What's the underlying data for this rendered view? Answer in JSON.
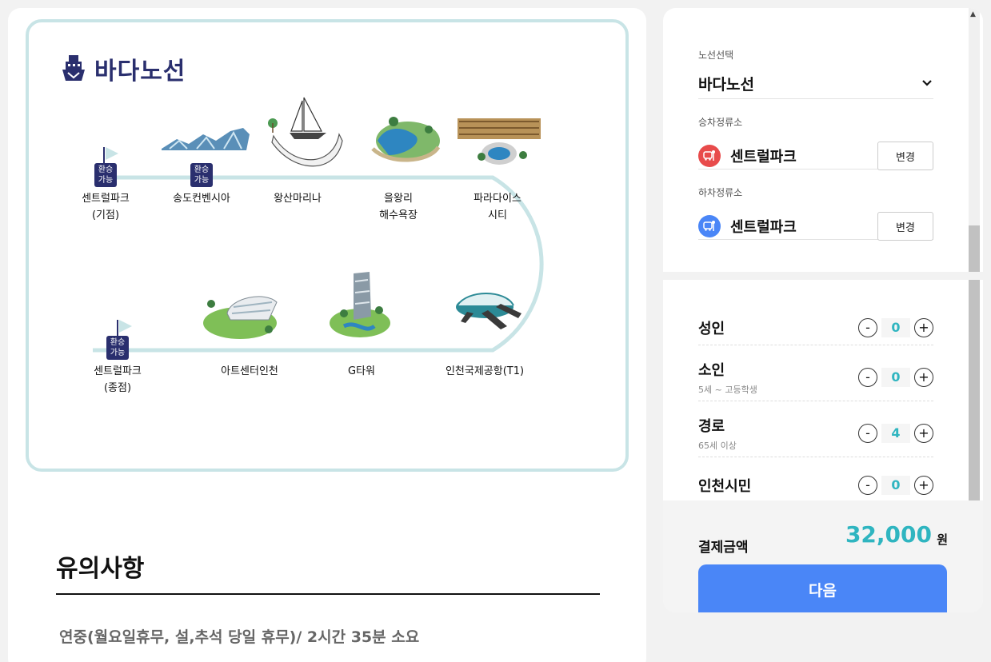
{
  "brand": {
    "name": "바다노선"
  },
  "route_map": {
    "stops": [
      {
        "label": "센트럴파크\n(기점)",
        "transfer": true
      },
      {
        "label": "송도컨벤시아",
        "transfer": true
      },
      {
        "label": "왕산마리나",
        "transfer": false
      },
      {
        "label": "을왕리\n해수욕장",
        "transfer": false
      },
      {
        "label": "파라다이스\n시티",
        "transfer": false
      },
      {
        "label": "인천국제공항(T1)",
        "transfer": false
      },
      {
        "label": "G타워",
        "transfer": false
      },
      {
        "label": "아트센터인천",
        "transfer": false
      },
      {
        "label": "센트럴파크\n(종점)",
        "transfer": true
      }
    ],
    "transfer_text": "환승\n가능",
    "colors": {
      "path": "#c8e4e6",
      "badge": "#2a2f6e"
    }
  },
  "notice": {
    "title": "유의사항",
    "text": "연중(월요일휴무, 설,추석 당일 휴무)/ 2시간 35분 소요"
  },
  "booking": {
    "route_label": "노선선택",
    "route_value": "바다노선",
    "boarding": {
      "label": "승차정류소",
      "stop": "센트럴파크",
      "button": "변경",
      "icon_color": "#e84b4b"
    },
    "alighting": {
      "label": "하차정류소",
      "stop": "센트럴파크",
      "button": "변경",
      "icon_color": "#4a86f7"
    },
    "passengers": [
      {
        "name": "성인",
        "sub": "",
        "count": "0"
      },
      {
        "name": "소인",
        "sub": "5세 ~ 고등학생",
        "count": "0"
      },
      {
        "name": "경로",
        "sub": "65세 이상",
        "count": "4"
      },
      {
        "name": "인천시민",
        "sub": "",
        "count": "0"
      }
    ],
    "minus": "-",
    "plus": "+",
    "payment": {
      "label": "결제금액",
      "amount": "32,000",
      "unit": "원"
    },
    "next_button": "다음",
    "accent_color": "#2fb5c0",
    "button_color": "#4a86f7"
  }
}
